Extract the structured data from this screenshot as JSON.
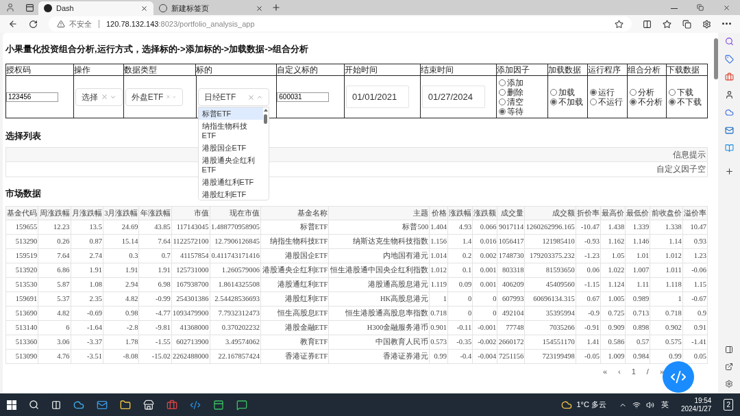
{
  "browser": {
    "tabs": [
      {
        "title": "Dash",
        "selected": true
      },
      {
        "title": "新建标签页",
        "selected": false
      }
    ],
    "security": "不安全",
    "url_host": "120.78.132.143",
    "url_rest": ":8023/portfolio_analysis_app"
  },
  "page": {
    "title": "小果量化投资组合分析,运行方式，选择标的->添加标的->加载数据->组合分析",
    "controls": {
      "columns": [
        "授权码",
        "操作",
        "数据类型",
        "标的",
        "自定义标的",
        "开始时间",
        "结束时间",
        "添加因子",
        "加载数据",
        "运行程序",
        "组合分析",
        "下载数据"
      ],
      "auth_code": "123456",
      "operation": {
        "value": "选择"
      },
      "data_type": {
        "value": "外盘ETF"
      },
      "target": {
        "value": "日经ETF",
        "expanded": true,
        "options": [
          {
            "label": "标普ETF",
            "selected": true
          },
          {
            "label": "纳指生物科技ETF",
            "selected": false
          },
          {
            "label": "港股国企ETF",
            "selected": false
          },
          {
            "label": "港股通央企红利ETF",
            "selected": false
          },
          {
            "label": "港股通红利ETF",
            "selected": false
          },
          {
            "label": "港股红利ETF",
            "selected": false
          }
        ]
      },
      "custom_target": "600031",
      "start_date": "01/01/2021",
      "end_date": "01/27/2024",
      "radio_groups": [
        [
          {
            "label": "添加",
            "selected": false
          },
          {
            "label": "删除",
            "selected": false
          },
          {
            "label": "清空",
            "selected": false
          },
          {
            "label": "等待",
            "selected": true
          }
        ],
        [
          {
            "label": "加载",
            "selected": false
          },
          {
            "label": "不加载",
            "selected": true
          }
        ],
        [
          {
            "label": "运行",
            "selected": true
          },
          {
            "label": "不运行",
            "selected": false
          }
        ],
        [
          {
            "label": "分析",
            "selected": false
          },
          {
            "label": "不分析",
            "selected": true
          }
        ],
        [
          {
            "label": "下载",
            "selected": false
          },
          {
            "label": "不下载",
            "selected": true
          }
        ]
      ]
    },
    "selection_list": {
      "title": "选择列表",
      "rows": [
        "信息提示",
        "自定义因子空"
      ]
    },
    "market": {
      "title": "市场数据",
      "columns": [
        "基金代码",
        "周涨跌幅",
        "月涨跌幅",
        "3月涨跌幅",
        "年涨跌幅",
        "市值",
        "现在市值",
        "基金名称",
        "主题",
        "价格",
        "涨跌幅",
        "涨跌额",
        "成交量",
        "成交额",
        "折价率",
        "最高价",
        "最低价",
        "前收盘价",
        "溢价率"
      ],
      "rows": [
        [
          "159655",
          "12.23",
          "13.5",
          "24.69",
          "43.85",
          "117143045",
          "1.488770958905",
          "标普ETF",
          "标普500",
          "1.404",
          "4.93",
          "0.066",
          "9017114",
          "1260262996.165",
          "-10.47",
          "1.438",
          "1.339",
          "1.338",
          "10.47"
        ],
        [
          "513290",
          "0.26",
          "0.87",
          "15.14",
          "7.64",
          "1122572100",
          "12.7906126845",
          "纳指生物科技ETF",
          "纳斯达克生物科技指数",
          "1.156",
          "1.4",
          "0.016",
          "1056417",
          "121985410",
          "-0.93",
          "1.162",
          "1.146",
          "1.14",
          "0.93"
        ],
        [
          "159519",
          "7.64",
          "2.74",
          "0.3",
          "0.7",
          "41157854",
          "0.411743171416",
          "港股国企ETF",
          "内地国有港元",
          "1.014",
          "0.2",
          "0.002",
          "1748730",
          "179203375.232",
          "-1.23",
          "1.05",
          "1.01",
          "1.012",
          "1.23"
        ],
        [
          "513920",
          "6.86",
          "1.91",
          "1.91",
          "1.91",
          "125731000",
          "1.260579006",
          "港股通央企红利ETF",
          "恒生港股通中国央企红利指数",
          "1.012",
          "0.1",
          "0.001",
          "803318",
          "81593650",
          "0.06",
          "1.022",
          "1.007",
          "1.011",
          "-0.06"
        ],
        [
          "513530",
          "5.87",
          "1.08",
          "2.94",
          "6.98",
          "167938700",
          "1.8614325508",
          "港股通红利ETF",
          "港股通高股息港元",
          "1.119",
          "0.09",
          "0.001",
          "406209",
          "45409560",
          "-1.15",
          "1.124",
          "1.11",
          "1.118",
          "1.15"
        ],
        [
          "159691",
          "5.37",
          "2.35",
          "4.82",
          "-0.99",
          "254301386",
          "2.54428536693",
          "港股红利ETF",
          "HK高股息港元",
          "1",
          "0",
          "0",
          "607993",
          "60696134.315",
          "0.67",
          "1.005",
          "0.989",
          "1",
          "-0.67"
        ],
        [
          "513690",
          "4.82",
          "-0.69",
          "0.98",
          "-4.77",
          "1093479900",
          "7.7932312473",
          "恒生高股息ETF",
          "恒生港股通高股息率指数",
          "0.718",
          "0",
          "0",
          "492104",
          "35395994",
          "-0.9",
          "0.725",
          "0.713",
          "0.718",
          "0.9"
        ],
        [
          "513140",
          "6",
          "-1.64",
          "-2.8",
          "-9.81",
          "41368000",
          "0.370202232",
          "港股金融ETF",
          "H300金融服务港币",
          "0.901",
          "-0.11",
          "-0.001",
          "77748",
          "7035266",
          "-0.91",
          "0.909",
          "0.898",
          "0.902",
          "0.91"
        ],
        [
          "513360",
          "3.06",
          "-3.37",
          "1.78",
          "-1.55",
          "602713900",
          "3.49574062",
          "教育ETF",
          "中国教育人民币",
          "0.573",
          "-0.35",
          "-0.002",
          "2660172",
          "154551170",
          "1.41",
          "0.586",
          "0.57",
          "0.575",
          "-1.41"
        ],
        [
          "513090",
          "4.76",
          "-3.51",
          "-8.08",
          "-15.02",
          "2262488000",
          "22.167857424",
          "香港证券ETF",
          "香港证券港元",
          "0.99",
          "-0.4",
          "-0.004",
          "7251156",
          "723199498",
          "-0.05",
          "1.009",
          "0.984",
          "0.99",
          "0.05"
        ]
      ]
    },
    "pagination": [
      "«",
      "‹",
      "1",
      "/",
      "»"
    ]
  },
  "taskbar": {
    "weather": "1°C 多云",
    "ime": "英",
    "time": "19:54",
    "date": "2024/1/27",
    "notifications": "2"
  }
}
